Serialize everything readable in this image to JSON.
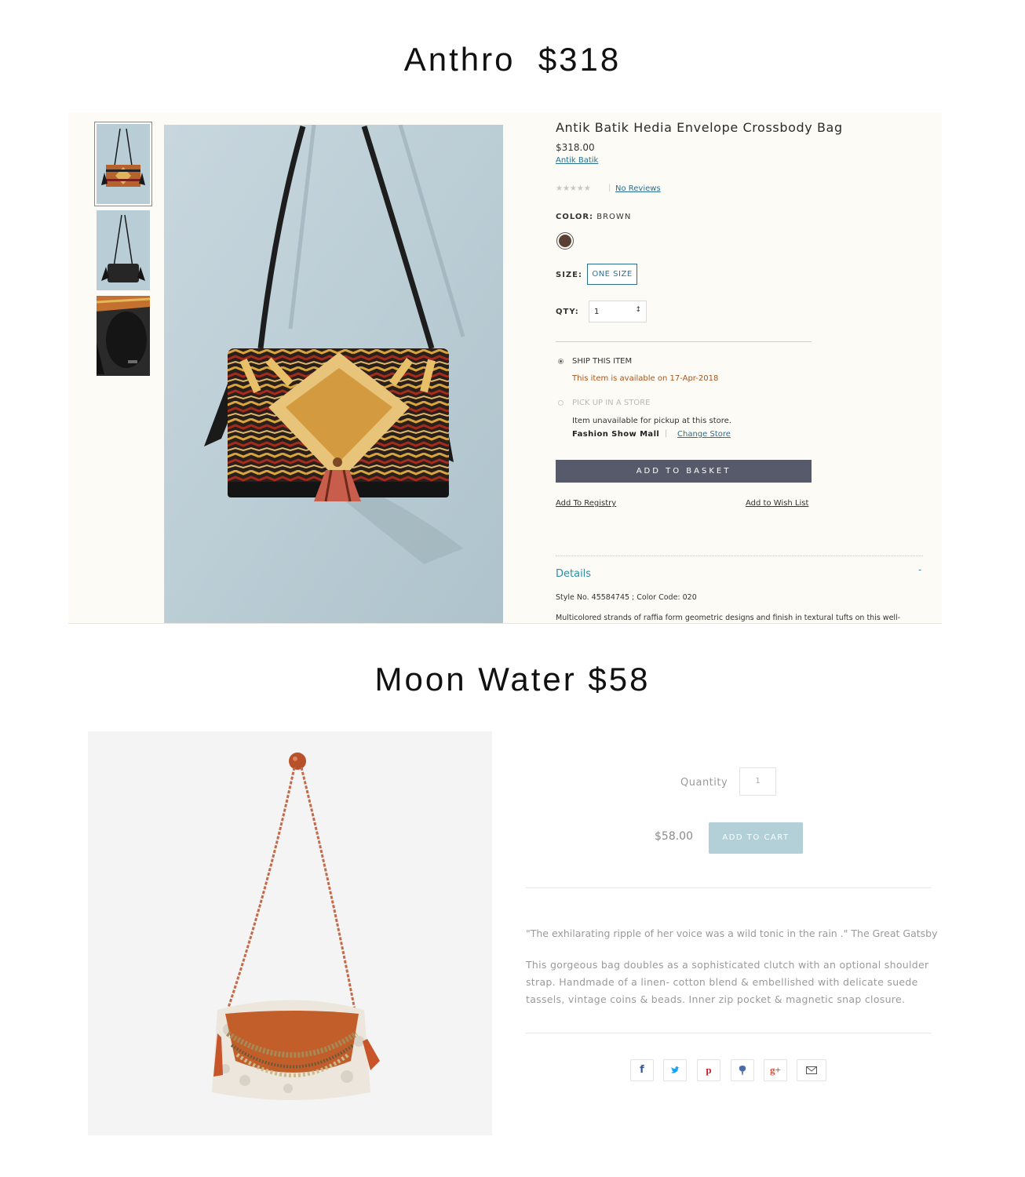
{
  "headings": {
    "anthro": "Anthro  $318",
    "moonwater": "Moon Water $58"
  },
  "anthro": {
    "title": "Antik Batik Hedia Envelope Crossbody Bag",
    "price": "$318.00",
    "brand": "Antik Batik",
    "stars": "★★★★★",
    "reviews": "No Reviews",
    "color_label": "COLOR:",
    "color_value": "BROWN",
    "size_label": "SIZE:",
    "size_option": "ONE SIZE",
    "qty_label": "QTY:",
    "qty_value": "1",
    "ship_label": "SHIP THIS ITEM",
    "ship_availability": "This item is available on 17-Apr-2018",
    "pickup_label": "PICK UP IN A STORE",
    "pickup_status": "Item unavailable for pickup at this store.",
    "store_name": "Fashion Show Mall",
    "change_store": "Change Store",
    "add_to_basket": "ADD TO BASKET",
    "add_to_registry": "Add To Registry",
    "add_to_wishlist": "Add to Wish List",
    "details_heading": "Details",
    "details_toggle": "-",
    "style_no": "Style No. 45584745 ; Color Code: 020",
    "description": "Multicolored strands of raffia form geometric designs and finish in textural tufts on this well-",
    "colors": {
      "basket_button": "#565a6b",
      "link": "#2b6f8f",
      "availability": "#a8561e",
      "swatch": "#5a4032"
    }
  },
  "moonwater": {
    "quantity_label": "Quantity",
    "quantity_value": "1",
    "price": "$58.00",
    "add_to_cart": "ADD TO CART",
    "quote": "\"The exhilarating ripple of her voice was a wild tonic in the rain .\" The Great Gatsby",
    "description_lines": [
      "This gorgeous bag doubles as a sophisticated clutch with an optional shoulder",
      "strap. Handmade of a linen- cotton blend & embellished with delicate suede",
      "tassels, vintage coins & beads.  Inner zip pocket  & magnetic snap closure."
    ],
    "share_icons": [
      "facebook-icon",
      "twitter-icon",
      "pinterest-icon",
      "fancy-icon",
      "google-plus-icon",
      "email-icon"
    ],
    "colors": {
      "cart_button": "#b3cfd8",
      "facebook": "#3b5998",
      "twitter": "#1da1f2",
      "pinterest": "#cb2027",
      "fancy": "#4a6da7",
      "google_plus": "#dd4b39"
    }
  }
}
